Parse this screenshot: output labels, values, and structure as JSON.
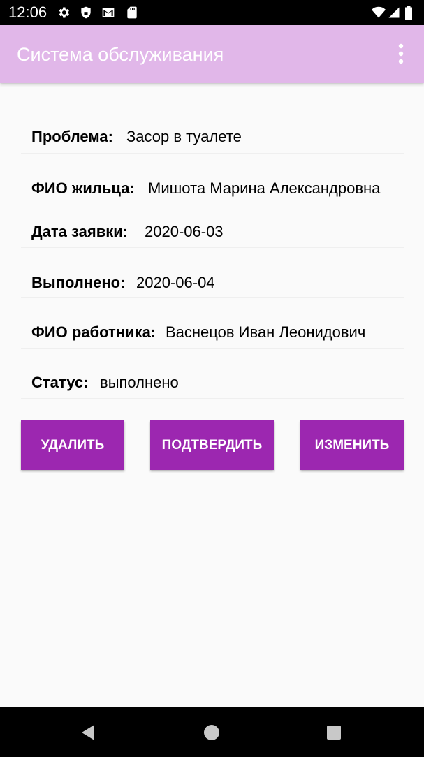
{
  "status_bar": {
    "time": "12:06",
    "icons": [
      "gear-icon",
      "shield-icon",
      "gmail-icon",
      "sd-card-icon",
      "wifi-icon",
      "signal-icon",
      "battery-icon"
    ]
  },
  "app_bar": {
    "title": "Система обслуживания",
    "background": "#e1b7e9",
    "menu_icon": "more-vert-icon"
  },
  "details": {
    "problem": {
      "label": "Проблема:",
      "value": "Засор в туалете"
    },
    "resident": {
      "label": "ФИО жильца:",
      "value": "Мишота Марина Александровна"
    },
    "request_date": {
      "label": "Дата заявки:",
      "value": "2020-06-03"
    },
    "completed": {
      "label": "Выполнено:",
      "value": "2020-06-04"
    },
    "worker": {
      "label": "ФИО работника:",
      "value": "Васнецов Иван Леонидович"
    },
    "status": {
      "label": "Статус:",
      "value": "выполнено"
    }
  },
  "actions": {
    "delete_label": "УДАЛИТЬ",
    "confirm_label": "ПОДТВЕРДИТЬ",
    "edit_label": "ИЗМЕНИТЬ",
    "color": "#9c27b0"
  },
  "nav_bar": {
    "icons": [
      "back-icon",
      "home-icon",
      "recents-icon"
    ]
  }
}
